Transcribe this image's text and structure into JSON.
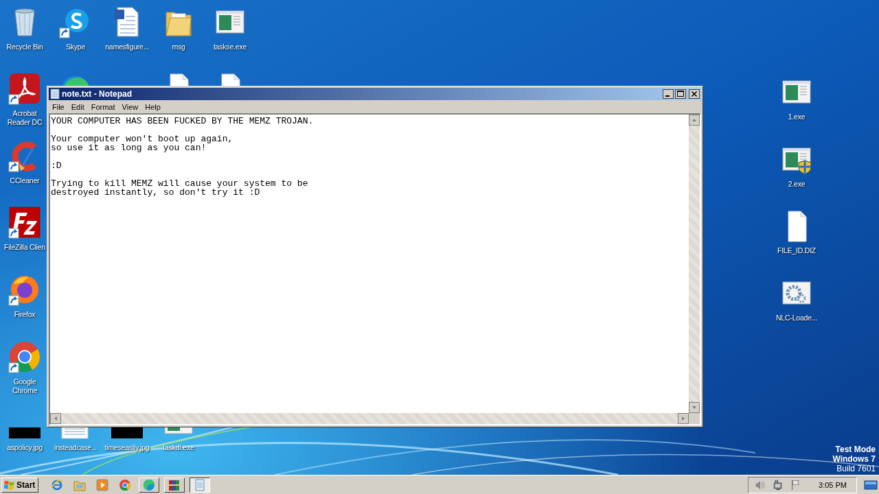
{
  "desktop": {
    "icons": [
      {
        "label": "Recycle Bin",
        "kind": "recycle-bin",
        "shortcut": false
      },
      {
        "label": "Skype",
        "kind": "skype",
        "shortcut": true
      },
      {
        "label": "namesfigure...",
        "kind": "word-doc",
        "shortcut": false
      },
      {
        "label": "msg",
        "kind": "folder",
        "shortcut": false
      },
      {
        "label": "taskse.exe",
        "kind": "exe",
        "shortcut": false
      },
      {
        "label": "Acrobat Reader DC",
        "kind": "acrobat",
        "shortcut": true
      },
      {
        "kind": "edge"
      },
      {
        "kind": "file"
      },
      {
        "kind": "file"
      },
      {
        "label": "CCleaner",
        "kind": "ccleaner",
        "shortcut": true
      },
      {
        "label": "FileZilla Clien",
        "kind": "filezilla",
        "shortcut": true
      },
      {
        "label": "Firefox",
        "kind": "firefox",
        "shortcut": true
      },
      {
        "label": "Google Chrome",
        "kind": "chrome",
        "shortcut": true
      },
      {
        "label": "aspolicy.jpg",
        "kind": "black-image",
        "shortcut": false
      },
      {
        "label": "insteadcase...",
        "kind": "document",
        "shortcut": false
      },
      {
        "label": "timeseasily.jpg",
        "kind": "black-image",
        "shortcut": false
      },
      {
        "label": "taskdl.exe",
        "kind": "exe",
        "shortcut": false
      },
      {
        "label": "1.exe",
        "kind": "exe",
        "shortcut": false
      },
      {
        "label": "2.exe",
        "kind": "exe-shield",
        "shortcut": false
      },
      {
        "label": "FILE_ID.DIZ",
        "kind": "file",
        "shortcut": false
      },
      {
        "label": "NLC-Loade...",
        "kind": "gear-exe",
        "shortcut": false
      }
    ],
    "os_notice": [
      {
        "text": "Test Mode",
        "bold": true
      },
      {
        "text": "Windows 7",
        "bold": true
      },
      {
        "text": "Build 7601",
        "bold": false
      }
    ]
  },
  "notepad": {
    "title": "note.txt - Notepad",
    "menu": [
      "File",
      "Edit",
      "Format",
      "View",
      "Help"
    ],
    "content": "YOUR COMPUTER HAS BEEN FUCKED BY THE MEMZ TROJAN.\n\nYour computer won't boot up again,\nso use it as long as you can!\n\n:D\n\nTrying to kill MEMZ will cause your system to be\ndestroyed instantly, so don't try it :D"
  },
  "taskbar": {
    "start": "Start",
    "items": [
      {
        "kind": "ie",
        "open": false,
        "selected": false
      },
      {
        "kind": "explorer",
        "open": false,
        "selected": false
      },
      {
        "kind": "media-player",
        "open": false,
        "selected": false
      },
      {
        "kind": "chrome",
        "open": false,
        "selected": false
      },
      {
        "kind": "edge",
        "open": true,
        "selected": false
      },
      {
        "kind": "winrar",
        "open": true,
        "selected": false
      },
      {
        "kind": "notepad",
        "open": true,
        "selected": true
      }
    ],
    "tray": {
      "icons": [
        {
          "kind": "volume"
        },
        {
          "kind": "network"
        },
        {
          "kind": "flag"
        }
      ],
      "clock": "3:05 PM"
    }
  }
}
